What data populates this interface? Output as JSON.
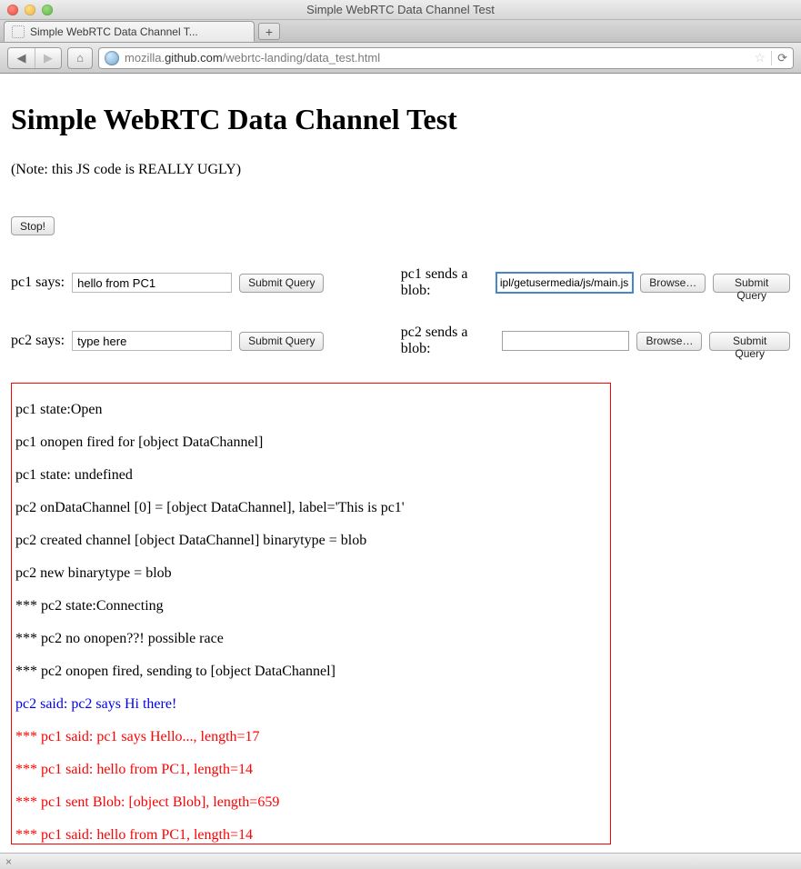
{
  "window": {
    "title": "Simple WebRTC Data Channel Test"
  },
  "tab": {
    "title": "Simple WebRTC Data Channel T..."
  },
  "newtab_glyph": "+",
  "nav": {
    "back": "◀",
    "fwd": "▶",
    "home": "⌂",
    "url_prefix": "mozilla.",
    "url_host": "github.com",
    "url_path": "/webrtc-landing/data_test.html",
    "star": "☆",
    "reload": "⟳"
  },
  "page": {
    "heading": "Simple WebRTC Data Channel Test",
    "note": "(Note: this JS code is REALLY UGLY)",
    "stop_label": "Stop!",
    "pc1_says_label": "pc1 says:",
    "pc1_says_value": "hello from PC1",
    "pc2_says_label": "pc2 says:",
    "pc2_says_value": "type here",
    "submit_label": "Submit Query",
    "pc1_blob_label": "pc1 sends a blob:",
    "pc1_blob_file": "ipl/getusermedia/js/main.js",
    "pc2_blob_label": "pc2 sends a blob:",
    "pc2_blob_file": "",
    "browse_label": "Browse…"
  },
  "log": [
    {
      "text": "pc1 state:Open",
      "cls": ""
    },
    {
      "text": "pc1 onopen fired for [object DataChannel]",
      "cls": ""
    },
    {
      "text": "pc1 state: undefined",
      "cls": ""
    },
    {
      "text": "pc2 onDataChannel [0] = [object DataChannel], label='This is pc1'",
      "cls": ""
    },
    {
      "text": "pc2 created channel [object DataChannel] binarytype = blob",
      "cls": ""
    },
    {
      "text": "pc2 new binarytype = blob",
      "cls": ""
    },
    {
      "text": "*** pc2 state:Connecting",
      "cls": ""
    },
    {
      "text": "*** pc2 no onopen??! possible race",
      "cls": ""
    },
    {
      "text": "*** pc2 onopen fired, sending to [object DataChannel]",
      "cls": ""
    },
    {
      "text": "pc2 said: pc2 says Hi there!",
      "cls": "blue"
    },
    {
      "text": "*** pc1 said: pc1 says Hello..., length=17",
      "cls": "red"
    },
    {
      "text": "*** pc1 said: hello from PC1, length=14",
      "cls": "red"
    },
    {
      "text": "*** pc1 sent Blob: [object Blob], length=659",
      "cls": "red"
    },
    {
      "text": "*** pc1 said: hello from PC1, length=14",
      "cls": "red"
    }
  ],
  "addonbar_close": "×"
}
